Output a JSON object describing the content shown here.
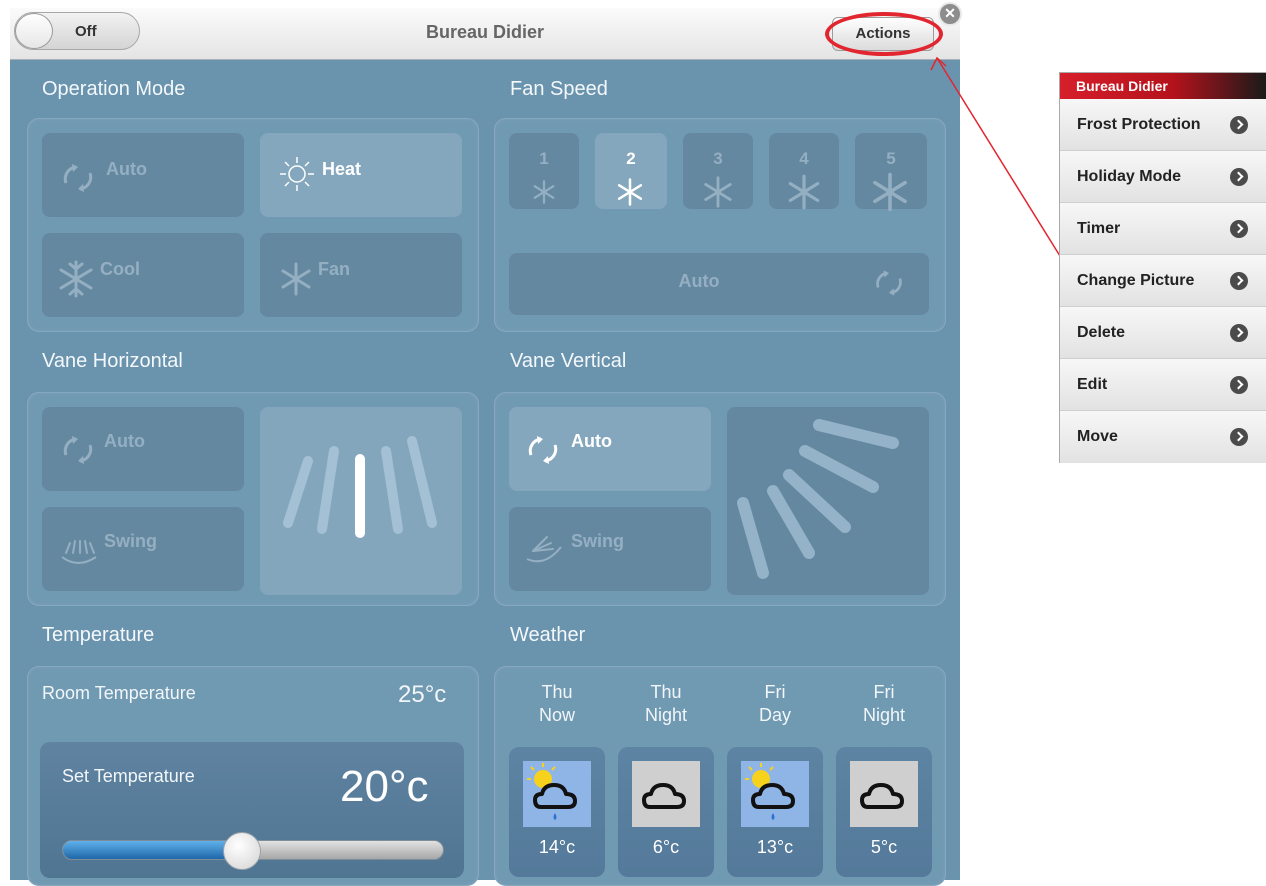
{
  "header": {
    "power_label": "Off",
    "title": "Bureau Didier",
    "actions_label": "Actions",
    "close_glyph": "✕"
  },
  "operation_mode": {
    "title": "Operation Mode",
    "items": [
      {
        "label": "Auto",
        "icon": "auto-cycle-icon",
        "active": false
      },
      {
        "label": "Heat",
        "icon": "sun-icon",
        "active": true
      },
      {
        "label": "Cool",
        "icon": "snowflake-icon",
        "active": false
      },
      {
        "label": "Fan",
        "icon": "fan-icon",
        "active": false
      }
    ]
  },
  "fan_speed": {
    "title": "Fan Speed",
    "levels": [
      "1",
      "2",
      "3",
      "4",
      "5"
    ],
    "selected": "2",
    "auto_label": "Auto"
  },
  "vane_horizontal": {
    "title": "Vane Horizontal",
    "auto_label": "Auto",
    "swing_label": "Swing"
  },
  "vane_vertical": {
    "title": "Vane Vertical",
    "auto_label": "Auto",
    "swing_label": "Swing",
    "auto_active": true
  },
  "temperature": {
    "title": "Temperature",
    "room_label": "Room Temperature",
    "room_value": "25°c",
    "set_label": "Set Temperature",
    "set_value": "20°c",
    "slider_level": 0.47
  },
  "weather": {
    "title": "Weather",
    "days": [
      {
        "line1": "Thu",
        "line2": "Now",
        "temp": "14°c",
        "icon": "sun-cloud-rain-icon",
        "kind": "day"
      },
      {
        "line1": "Thu",
        "line2": "Night",
        "temp": "6°c",
        "icon": "cloud-icon",
        "kind": "night"
      },
      {
        "line1": "Fri",
        "line2": "Day",
        "temp": "13°c",
        "icon": "sun-cloud-rain-icon",
        "kind": "day"
      },
      {
        "line1": "Fri",
        "line2": "Night",
        "temp": "5°c",
        "icon": "cloud-icon",
        "kind": "night"
      }
    ]
  },
  "actions_menu": {
    "title": "Bureau Didier",
    "items": [
      "Frost Protection",
      "Holiday Mode",
      "Timer",
      "Change Picture",
      "Delete",
      "Edit",
      "Move"
    ]
  },
  "colors": {
    "panel_bg": "#6a93ad",
    "highlight": "#e2262f",
    "menu_header": "#c8141f"
  }
}
